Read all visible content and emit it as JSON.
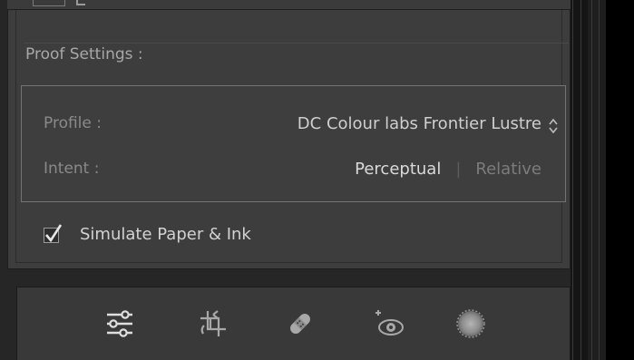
{
  "proof": {
    "title": "Proof Settings :",
    "profile_label": "Profile :",
    "profile_value": "DC Colour labs Frontier Lustre",
    "intent_label": "Intent :",
    "intent_options": [
      "Perceptual",
      "Relative"
    ],
    "intent_divider": "|",
    "intent_selected": "Perceptual"
  },
  "simulate": {
    "label": "Simulate Paper & Ink",
    "checked": true
  },
  "toolbar": {
    "tools": [
      {
        "name": "adjust-sliders-icon"
      },
      {
        "name": "crop-rotate-icon"
      },
      {
        "name": "healing-bandage-icon"
      },
      {
        "name": "red-eye-icon"
      },
      {
        "name": "radial-filter-icon"
      }
    ]
  },
  "colors": {
    "panel": "#3d3d3d",
    "box_border": "#737373",
    "text_primary": "#d2d2d2",
    "text_muted": "#8a8a8a"
  }
}
